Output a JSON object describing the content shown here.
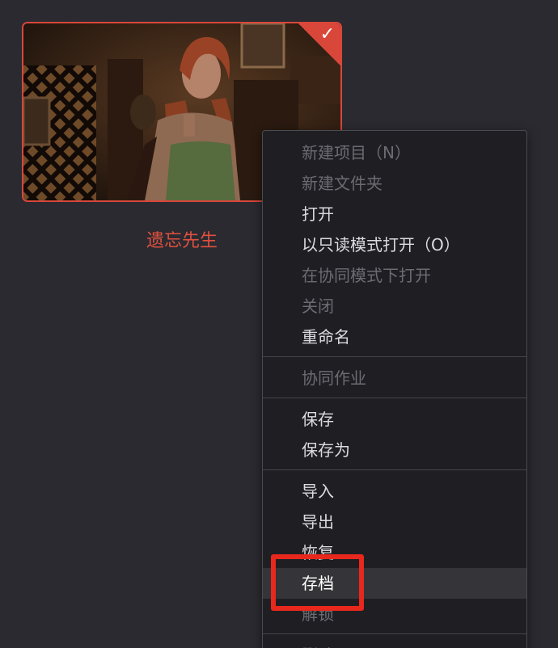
{
  "project": {
    "name": "遗忘先生",
    "selected_check_icon": "checkmark-icon",
    "accent_color": "#d8473a"
  },
  "menu": {
    "groups": [
      [
        {
          "label": "新建项目（N）",
          "enabled": false
        },
        {
          "label": "新建文件夹",
          "enabled": false
        },
        {
          "label": "打开",
          "enabled": true
        },
        {
          "label": "以只读模式打开（O）",
          "enabled": true
        },
        {
          "label": "在协同模式下打开",
          "enabled": false
        },
        {
          "label": "关闭",
          "enabled": false
        },
        {
          "label": "重命名",
          "enabled": true
        }
      ],
      [
        {
          "label": "协同作业",
          "enabled": false
        }
      ],
      [
        {
          "label": "保存",
          "enabled": true
        },
        {
          "label": "保存为",
          "enabled": true
        }
      ],
      [
        {
          "label": "导入",
          "enabled": true
        },
        {
          "label": "导出",
          "enabled": true
        },
        {
          "label": "恢复",
          "enabled": true
        },
        {
          "label": "存档",
          "enabled": true,
          "hovered": true
        },
        {
          "label": "解锁",
          "enabled": false
        }
      ],
      [
        {
          "label": "删除",
          "enabled": false
        }
      ]
    ]
  },
  "annotation": {
    "target": "存档",
    "color": "#e8281c"
  }
}
